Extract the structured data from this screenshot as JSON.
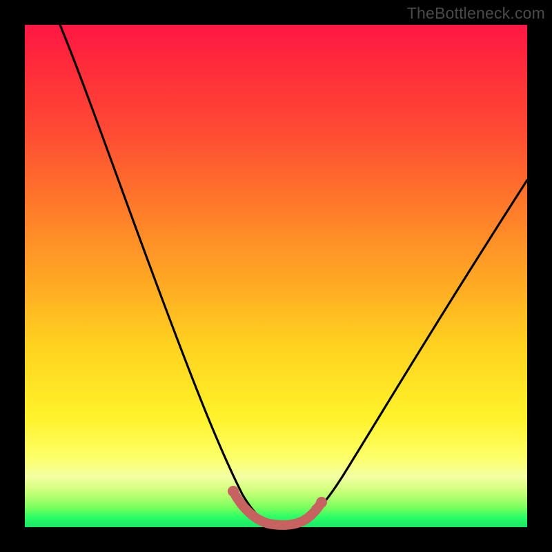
{
  "watermark": "TheBottleneck.com",
  "chart_data": {
    "type": "line",
    "title": "",
    "xlabel": "",
    "ylabel": "",
    "xlim": [
      0,
      100
    ],
    "ylim": [
      0,
      100
    ],
    "grid": false,
    "legend": false,
    "series": [
      {
        "name": "curve",
        "color": "#000000",
        "x": [
          7,
          10,
          14,
          18,
          22,
          26,
          30,
          34,
          38,
          41,
          43,
          45,
          47,
          49,
          51,
          53,
          55,
          58,
          62,
          66,
          70,
          74,
          78,
          82,
          86,
          90,
          94,
          98,
          100
        ],
        "y": [
          100,
          92,
          82,
          72,
          62,
          52,
          42,
          33,
          24,
          17,
          12,
          7,
          3,
          1,
          0,
          0,
          1,
          4,
          10,
          17,
          24,
          31,
          38,
          44,
          50,
          56,
          61,
          66,
          69
        ]
      },
      {
        "name": "bottom-highlight",
        "color": "#c6625f",
        "x": [
          41,
          43,
          45,
          47,
          49,
          51,
          53,
          55,
          57
        ],
        "y": [
          7,
          4,
          2,
          1,
          0,
          0,
          1,
          2,
          4
        ]
      }
    ],
    "markers": [
      {
        "series": "bottom-highlight",
        "x": 41,
        "y": 7
      },
      {
        "series": "bottom-highlight",
        "x": 54,
        "y": 1
      },
      {
        "series": "bottom-highlight",
        "x": 55,
        "y": 2
      },
      {
        "series": "bottom-highlight",
        "x": 56,
        "y": 3
      },
      {
        "series": "bottom-highlight",
        "x": 57,
        "y": 4
      }
    ]
  }
}
